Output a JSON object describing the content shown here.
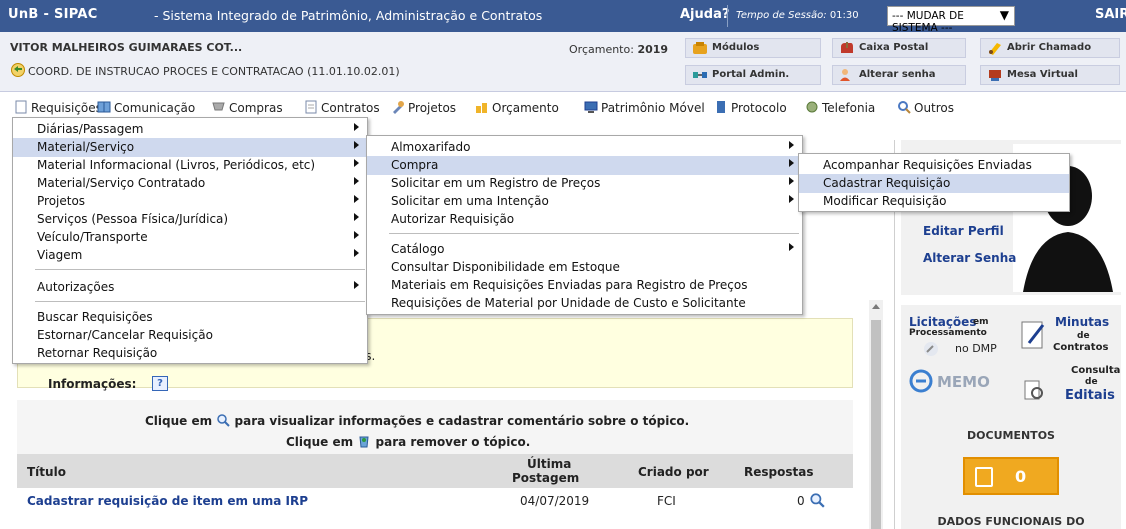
{
  "header": {
    "app_title": "UnB - SIPAC",
    "app_subtitle": "- Sistema Integrado de Patrimônio, Administração e Contratos",
    "help": "Ajuda?",
    "session_label": "Tempo de Sessão:",
    "session_time": "01:30",
    "system_select": "--- MUDAR DE SISTEMA ---",
    "logout": "SAIR"
  },
  "user": {
    "name": "VITOR MALHEIROS GUIMARAES COT...",
    "unit": "COORD. DE INSTRUCAO PROCES E CONTRATACAO (11.01.10.02.01)",
    "budget_label": "Orçamento:",
    "budget_year": "2019"
  },
  "shortcuts": [
    {
      "label": "Módulos"
    },
    {
      "label": "Caixa Postal"
    },
    {
      "label": "Abrir Chamado"
    },
    {
      "label": "Portal Admin."
    },
    {
      "label": "Alterar senha"
    },
    {
      "label": "Mesa Virtual"
    }
  ],
  "menu": [
    {
      "label": "Requisições"
    },
    {
      "label": "Comunicação"
    },
    {
      "label": "Compras"
    },
    {
      "label": "Contratos"
    },
    {
      "label": "Projetos"
    },
    {
      "label": "Orçamento"
    },
    {
      "label": "Patrimônio Móvel"
    },
    {
      "label": "Protocolo"
    },
    {
      "label": "Telefonia"
    },
    {
      "label": "Outros"
    }
  ],
  "dropdown1": [
    {
      "label": "Diárias/Passagem"
    },
    {
      "label": "Material/Serviço"
    },
    {
      "label": "Material Informacional (Livros, Periódicos, etc)"
    },
    {
      "label": "Material/Serviço Contratado"
    },
    {
      "label": "Projetos"
    },
    {
      "label": "Serviços (Pessoa Física/Jurídica)"
    },
    {
      "label": "Veículo/Transporte"
    },
    {
      "label": "Viagem"
    },
    {
      "label": "Autorizações"
    },
    {
      "label": "Buscar Requisições"
    },
    {
      "label": "Estornar/Cancelar Requisição"
    },
    {
      "label": "Retornar Requisição"
    }
  ],
  "dropdown2": [
    {
      "label": "Almoxarifado"
    },
    {
      "label": "Compra"
    },
    {
      "label": "Solicitar em um Registro de Preços"
    },
    {
      "label": "Solicitar em uma Intenção"
    },
    {
      "label": "Autorizar Requisição"
    },
    {
      "label": "Catálogo"
    },
    {
      "label": "Consultar Disponibilidade em Estoque"
    },
    {
      "label": "Materiais em Requisições Enviadas para Registro de Preços"
    },
    {
      "label": "Requisições de Material por Unidade de Custo e Solicitante"
    }
  ],
  "dropdown3": [
    {
      "label": "Acompanhar Requisições Enviadas"
    },
    {
      "label": "Cadastrar Requisição"
    },
    {
      "label": "Modificar Requisição"
    }
  ],
  "main": {
    "info_fragment": "rados.",
    "info_label": "Informações:",
    "click_prefix": "Clique em",
    "click_view": "para visualizar informações e cadastrar comentário sobre o tópico.",
    "click_remove": "para remover o tópico."
  },
  "table": {
    "headers": {
      "title": "Título",
      "last_post_1": "Última",
      "last_post_2": "Postagem",
      "created_by": "Criado por",
      "replies": "Respostas"
    },
    "rows": [
      {
        "title": "Cadastrar requisição de item em uma IRP",
        "date": "04/07/2019",
        "author": "FCI",
        "replies": "0"
      }
    ]
  },
  "sidebar": {
    "edit_profile": "Editar Perfil",
    "change_password": "Alterar Senha",
    "services": {
      "licitacoes_1": "Licitações",
      "licitacoes_2": "em",
      "licitacoes_3": "Processamento",
      "licitacoes_4": "no DMP",
      "minutas_1": "Minutas",
      "minutas_2": "de",
      "minutas_3": "Contratos",
      "memo": "MEMO",
      "consulta_1": "Consulta",
      "consulta_2": "de",
      "consulta_3": "Editais"
    },
    "documents_title": "DOCUMENTOS",
    "documents_count": "0",
    "functional_title": "DADOS FUNCIONAIS DO"
  }
}
